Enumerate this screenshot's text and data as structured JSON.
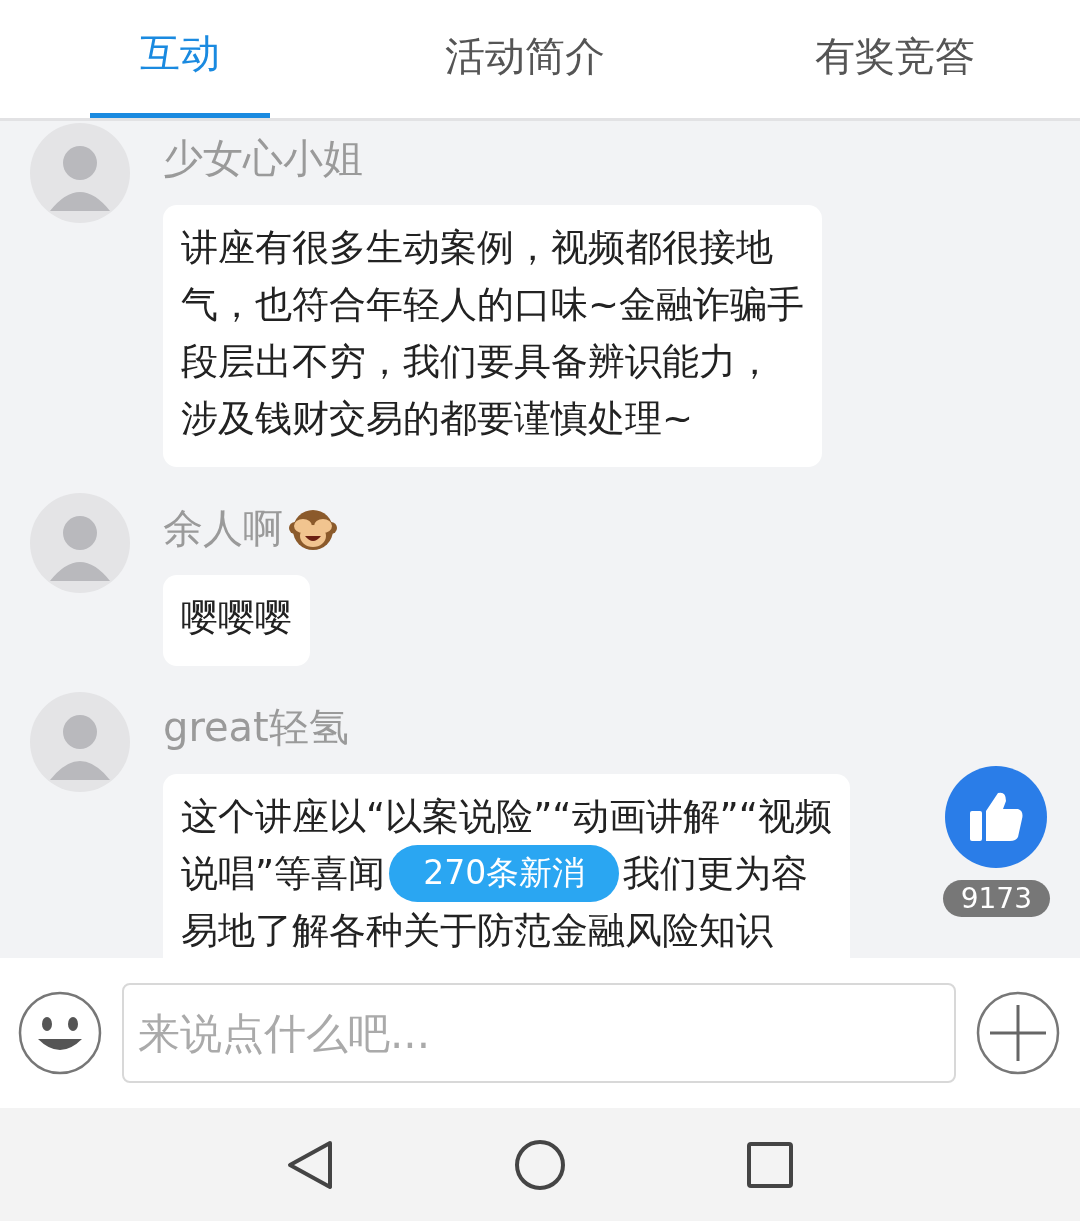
{
  "tabs": [
    {
      "label": "互动",
      "selected": true
    },
    {
      "label": "活动简介",
      "selected": false
    },
    {
      "label": "有奖竞答",
      "selected": false
    }
  ],
  "messages": [
    {
      "name": "少女心小姐",
      "emoji": false,
      "lines": [
        [
          "讲座有很多生动案例，视频都很接地"
        ],
        [
          "气，也符合年轻人的口味~金融诈骗手"
        ],
        [
          "段层出不穷，我们要具备辨识能力，"
        ],
        [
          "涉及钱财交易的都要谨慎处理~"
        ]
      ]
    },
    {
      "name": "余人啊",
      "emoji": true,
      "lines": [
        [
          "嘤嘤嘤"
        ]
      ]
    },
    {
      "name": "great轻氢",
      "emoji": false,
      "lines": [
        [
          "这个讲座以“以案说险”“动画讲解”“视频"
        ],
        [
          "说唱”等喜闻",
          {
            "kind": "badge",
            "text": "270条新消"
          },
          "我们更为容"
        ],
        [
          "易地了解各种关于防范金融风险知识"
        ]
      ]
    }
  ],
  "like": {
    "count": "9173"
  },
  "input": {
    "placeholder": "来说点什么吧..."
  }
}
